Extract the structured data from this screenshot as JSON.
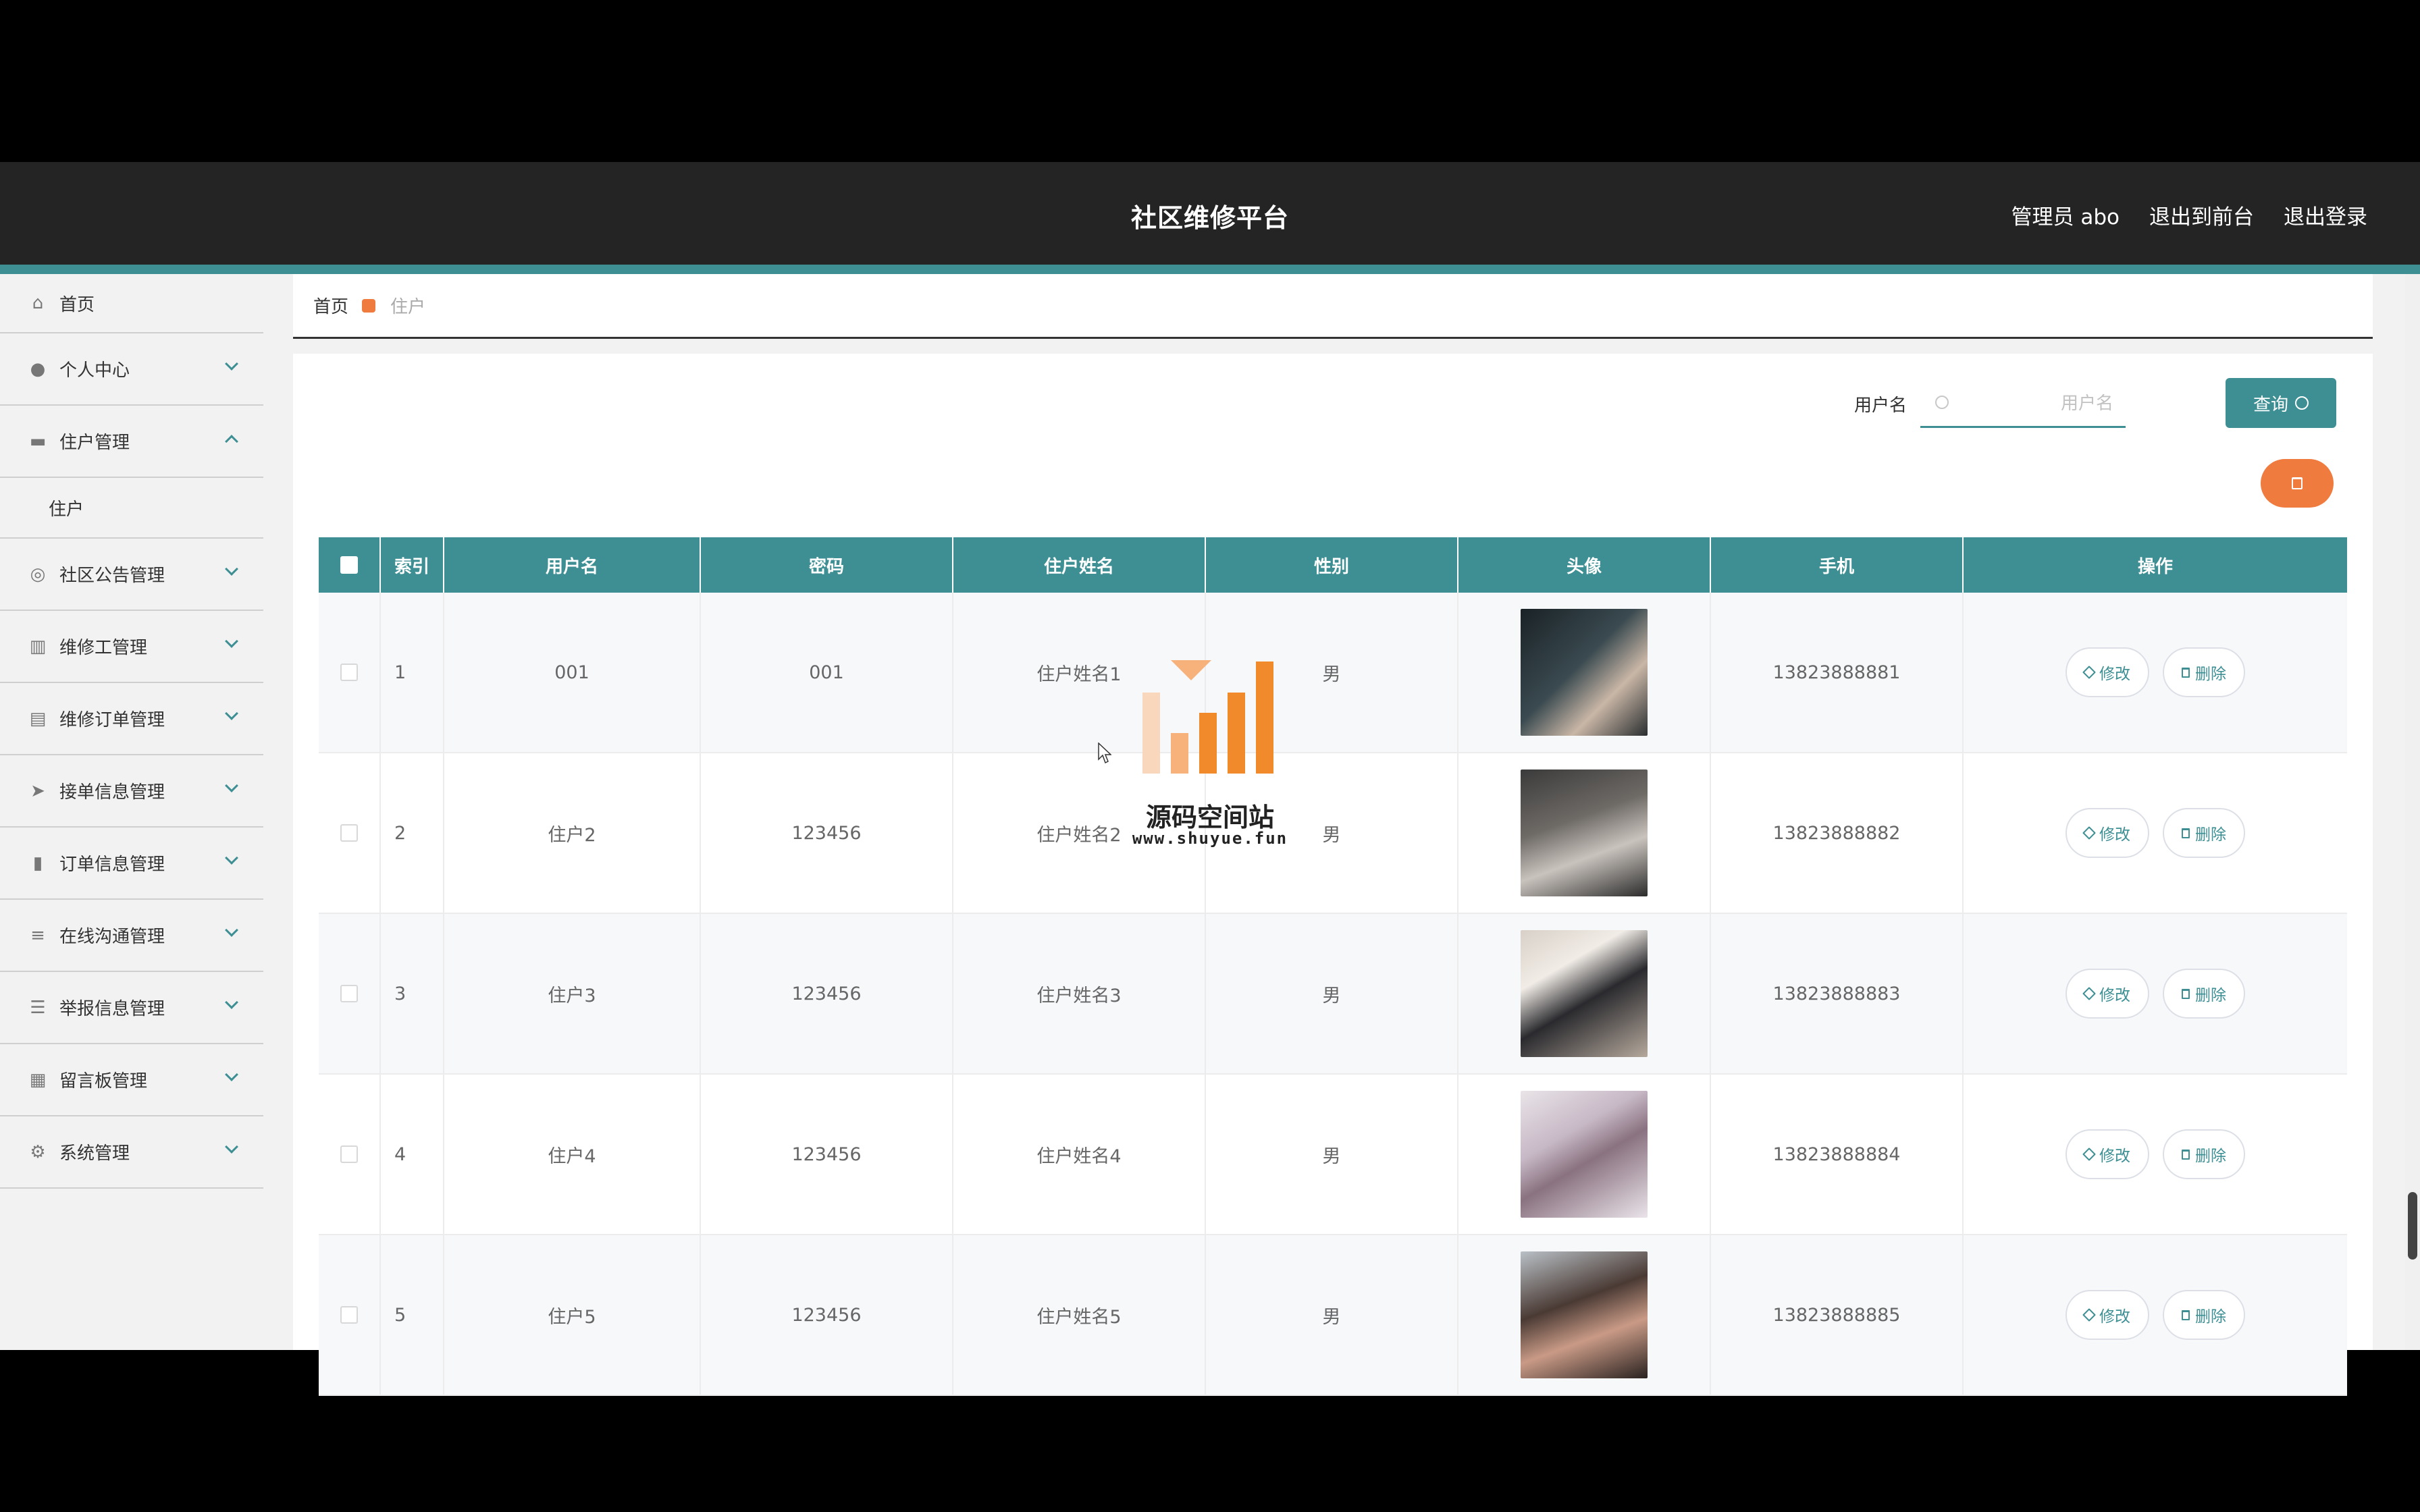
{
  "header": {
    "title": "社区维修平台",
    "user": "管理员 abo",
    "exit_front": "退出到前台",
    "logout": "退出登录"
  },
  "sidebar": {
    "items": [
      {
        "label": "首页",
        "icon": "home-icon"
      },
      {
        "label": "个人中心",
        "icon": "user-icon"
      },
      {
        "label": "住户管理",
        "icon": "monitor-icon",
        "expanded": true,
        "sub": [
          "住户"
        ]
      },
      {
        "label": "社区公告管理",
        "icon": "compass-icon"
      },
      {
        "label": "维修工管理",
        "icon": "chart-icon"
      },
      {
        "label": "维修订单管理",
        "icon": "clipboard-icon"
      },
      {
        "label": "接单信息管理",
        "icon": "send-icon"
      },
      {
        "label": "订单信息管理",
        "icon": "bar-chart-icon"
      },
      {
        "label": "在线沟通管理",
        "icon": "sliders-icon"
      },
      {
        "label": "举报信息管理",
        "icon": "list-icon"
      },
      {
        "label": "留言板管理",
        "icon": "grid-icon"
      },
      {
        "label": "系统管理",
        "icon": "settings-icon"
      }
    ]
  },
  "breadcrumb": {
    "home": "首页",
    "current": "住户"
  },
  "search": {
    "label": "用户名",
    "placeholder": "用户名",
    "value": "",
    "button": "查询"
  },
  "table": {
    "headers": [
      "索引",
      "用户名",
      "密码",
      "住户姓名",
      "性别",
      "头像",
      "手机",
      "操作"
    ],
    "edit_label": "修改",
    "delete_label": "删除",
    "rows": [
      {
        "index": "1",
        "username": "001",
        "password": "001",
        "name": "住户姓名1",
        "gender": "男",
        "phone": "13823888881"
      },
      {
        "index": "2",
        "username": "住户2",
        "password": "123456",
        "name": "住户姓名2",
        "gender": "男",
        "phone": "13823888882"
      },
      {
        "index": "3",
        "username": "住户3",
        "password": "123456",
        "name": "住户姓名3",
        "gender": "男",
        "phone": "13823888883"
      },
      {
        "index": "4",
        "username": "住户4",
        "password": "123456",
        "name": "住户姓名4",
        "gender": "男",
        "phone": "13823888884"
      },
      {
        "index": "5",
        "username": "住户5",
        "password": "123456",
        "name": "住户姓名5",
        "gender": "男",
        "phone": "13823888885"
      }
    ]
  },
  "watermark": {
    "text": "源码空间站",
    "url": "www.shuyue.fun"
  },
  "colors": {
    "accent": "#3d8f94",
    "danger": "#f07b3f",
    "header_bg": "#242424"
  }
}
